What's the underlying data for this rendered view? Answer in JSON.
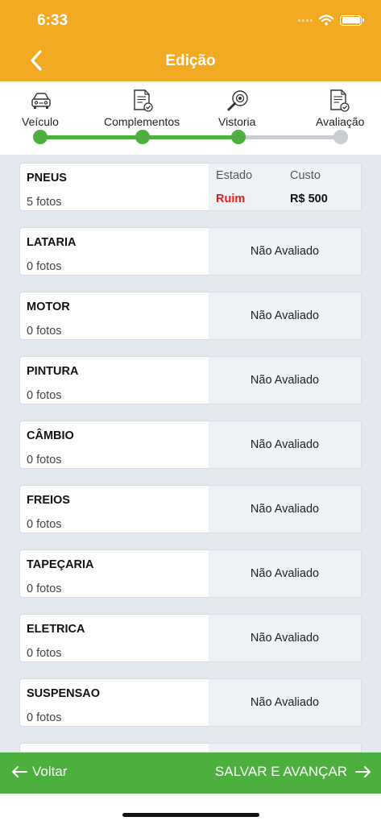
{
  "status_bar": {
    "time": "6:33"
  },
  "header": {
    "title": "Edição",
    "back_icon": "chevron-left-icon"
  },
  "stepper": {
    "steps": [
      {
        "label": "Veículo",
        "icon": "car-icon",
        "completed": true
      },
      {
        "label": "Complementos",
        "icon": "document-check-icon",
        "completed": true
      },
      {
        "label": "Vistoria",
        "icon": "inspection-magnifier-icon",
        "completed": true
      },
      {
        "label": "Avaliação",
        "icon": "document-check-icon",
        "completed": false
      }
    ],
    "active_color": "#4CAF3E",
    "inactive_color": "#C9CDD1"
  },
  "items": [
    {
      "name": "PNEUS",
      "photos": "5 fotos",
      "evaluated": true,
      "estado_label": "Estado",
      "estado_value": "Ruim",
      "custo_label": "Custo",
      "custo_value": "R$ 500"
    },
    {
      "name": "LATARIA",
      "photos": "0 fotos",
      "status": "Não Avaliado"
    },
    {
      "name": "MOTOR",
      "photos": "0 fotos",
      "status": "Não Avaliado"
    },
    {
      "name": "PINTURA",
      "photos": "0 fotos",
      "status": "Não Avaliado"
    },
    {
      "name": "CÂMBIO",
      "photos": "0 fotos",
      "status": "Não Avaliado"
    },
    {
      "name": "FREIOS",
      "photos": "0 fotos",
      "status": "Não Avaliado"
    },
    {
      "name": "TAPEÇARIA",
      "photos": "0 fotos",
      "status": "Não Avaliado"
    },
    {
      "name": "ELETRICA",
      "photos": "0 fotos",
      "status": "Não Avaliado"
    },
    {
      "name": "SUSPENSAO",
      "photos": "0 fotos",
      "status": "Não Avaliado"
    }
  ],
  "footer": {
    "back_label": "Voltar",
    "save_label": "SALVAR E AVANÇAR"
  },
  "colors": {
    "header": "#F2AA22",
    "footer": "#4CAF3E",
    "bad": "#E0211B"
  }
}
